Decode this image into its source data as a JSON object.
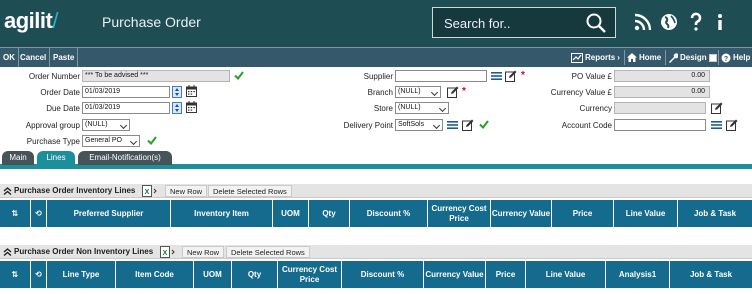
{
  "header": {
    "logo_text": "agilit",
    "logo_slash": "/",
    "page_title": "Purchase Order",
    "search_placeholder": "Search for.."
  },
  "toolbar": {
    "ok": "OK",
    "cancel": "Cancel",
    "paste": "Paste",
    "reports": "Reports",
    "home": "Home",
    "design": "Design",
    "help": "Help"
  },
  "form": {
    "order_number": {
      "label": "Order Number",
      "value": "*** To be advised ***"
    },
    "order_date": {
      "label": "Order Date",
      "value": "01/03/2019"
    },
    "due_date": {
      "label": "Due Date",
      "value": "01/03/2019"
    },
    "approval_group": {
      "label": "Approval group",
      "value": "(NULL)"
    },
    "purchase_type": {
      "label": "Purchase Type",
      "value": "General PO"
    },
    "supplier": {
      "label": "Supplier",
      "value": ""
    },
    "branch": {
      "label": "Branch",
      "value": "(NULL)"
    },
    "store": {
      "label": "Store",
      "value": "(NULL)"
    },
    "delivery_point": {
      "label": "Delivery Point",
      "value": "SoftSols"
    },
    "po_value": {
      "label": "PO Value £",
      "value": "0.00"
    },
    "currency_value": {
      "label": "Currency Value £",
      "value": "0.00"
    },
    "currency": {
      "label": "Currency",
      "value": ""
    },
    "account_code": {
      "label": "Account Code",
      "value": ""
    }
  },
  "tabs": [
    "Main",
    "Lines",
    "Email-Notification(s)"
  ],
  "inventory_grid": {
    "title": "Purchase Order Inventory Lines",
    "new_row": "New Row",
    "delete_rows": "Delete Selected Rows",
    "columns": [
      "Preferred Supplier",
      "Inventory Item",
      "UOM",
      "Qty",
      "Discount %",
      "Currency Cost Price",
      "Currency Value",
      "Price",
      "Line Value",
      "Job & Task"
    ]
  },
  "non_inventory_grid": {
    "title": "Purchase Order Non Inventory Lines",
    "new_row": "New Row",
    "delete_rows": "Delete Selected Rows",
    "columns": [
      "Line Type",
      "Item Code",
      "UOM",
      "Qty",
      "Currency Cost Price",
      "Discount %",
      "Currency Value",
      "Price",
      "Line Value",
      "Analysis1",
      "Job & Task"
    ]
  },
  "colors": {
    "header_bg": "#1f4d54",
    "toolbar_bg": "#35596b",
    "tab_active": "#1b8f9c",
    "grid_header": "#156b8e",
    "required_star": "#d0021b",
    "valid_check": "#27a12b"
  }
}
